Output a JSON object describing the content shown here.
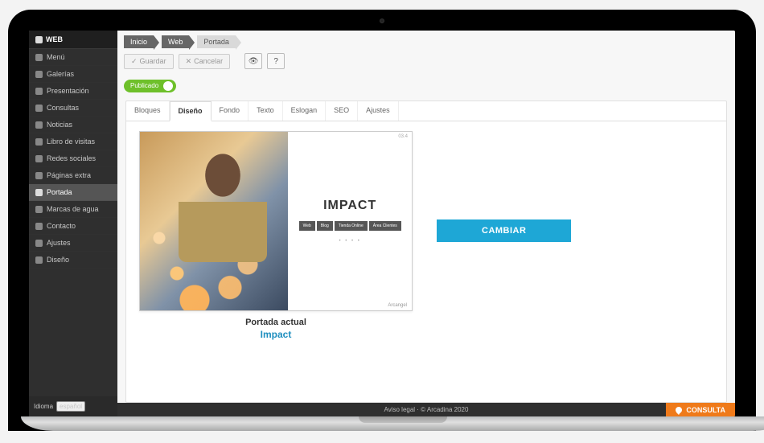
{
  "sidebar": {
    "header": "WEB",
    "items": [
      {
        "label": "Menú"
      },
      {
        "label": "Galerías"
      },
      {
        "label": "Presentación"
      },
      {
        "label": "Consultas"
      },
      {
        "label": "Noticias"
      },
      {
        "label": "Libro de visitas"
      },
      {
        "label": "Redes sociales"
      },
      {
        "label": "Páginas extra"
      },
      {
        "label": "Portada"
      },
      {
        "label": "Marcas de agua"
      },
      {
        "label": "Contacto"
      },
      {
        "label": "Ajustes"
      },
      {
        "label": "Diseño"
      }
    ],
    "lang_label": "Idioma",
    "lang_value": "español"
  },
  "breadcrumb": [
    "Inicio",
    "Web",
    "Portada"
  ],
  "toolbar": {
    "save": "Guardar",
    "cancel": "Cancelar"
  },
  "publish": {
    "state": "Publicado"
  },
  "tabs": [
    "Bloques",
    "Diseño",
    "Fondo",
    "Texto",
    "Eslogan",
    "SEO",
    "Ajustes"
  ],
  "active_tab": 1,
  "preview": {
    "brand": "IMPACT",
    "nav": [
      "Web",
      "Blog",
      "Tienda Online",
      "Área Clientes"
    ],
    "tag": "03.4",
    "foot": "Arcangel"
  },
  "captions": {
    "current": "Portada actual",
    "name": "Impact"
  },
  "change_btn": "CAMBIAR",
  "footer": {
    "copy": "Aviso legal  ·  © Arcadina 2020"
  },
  "consulta": "CONSULTA"
}
